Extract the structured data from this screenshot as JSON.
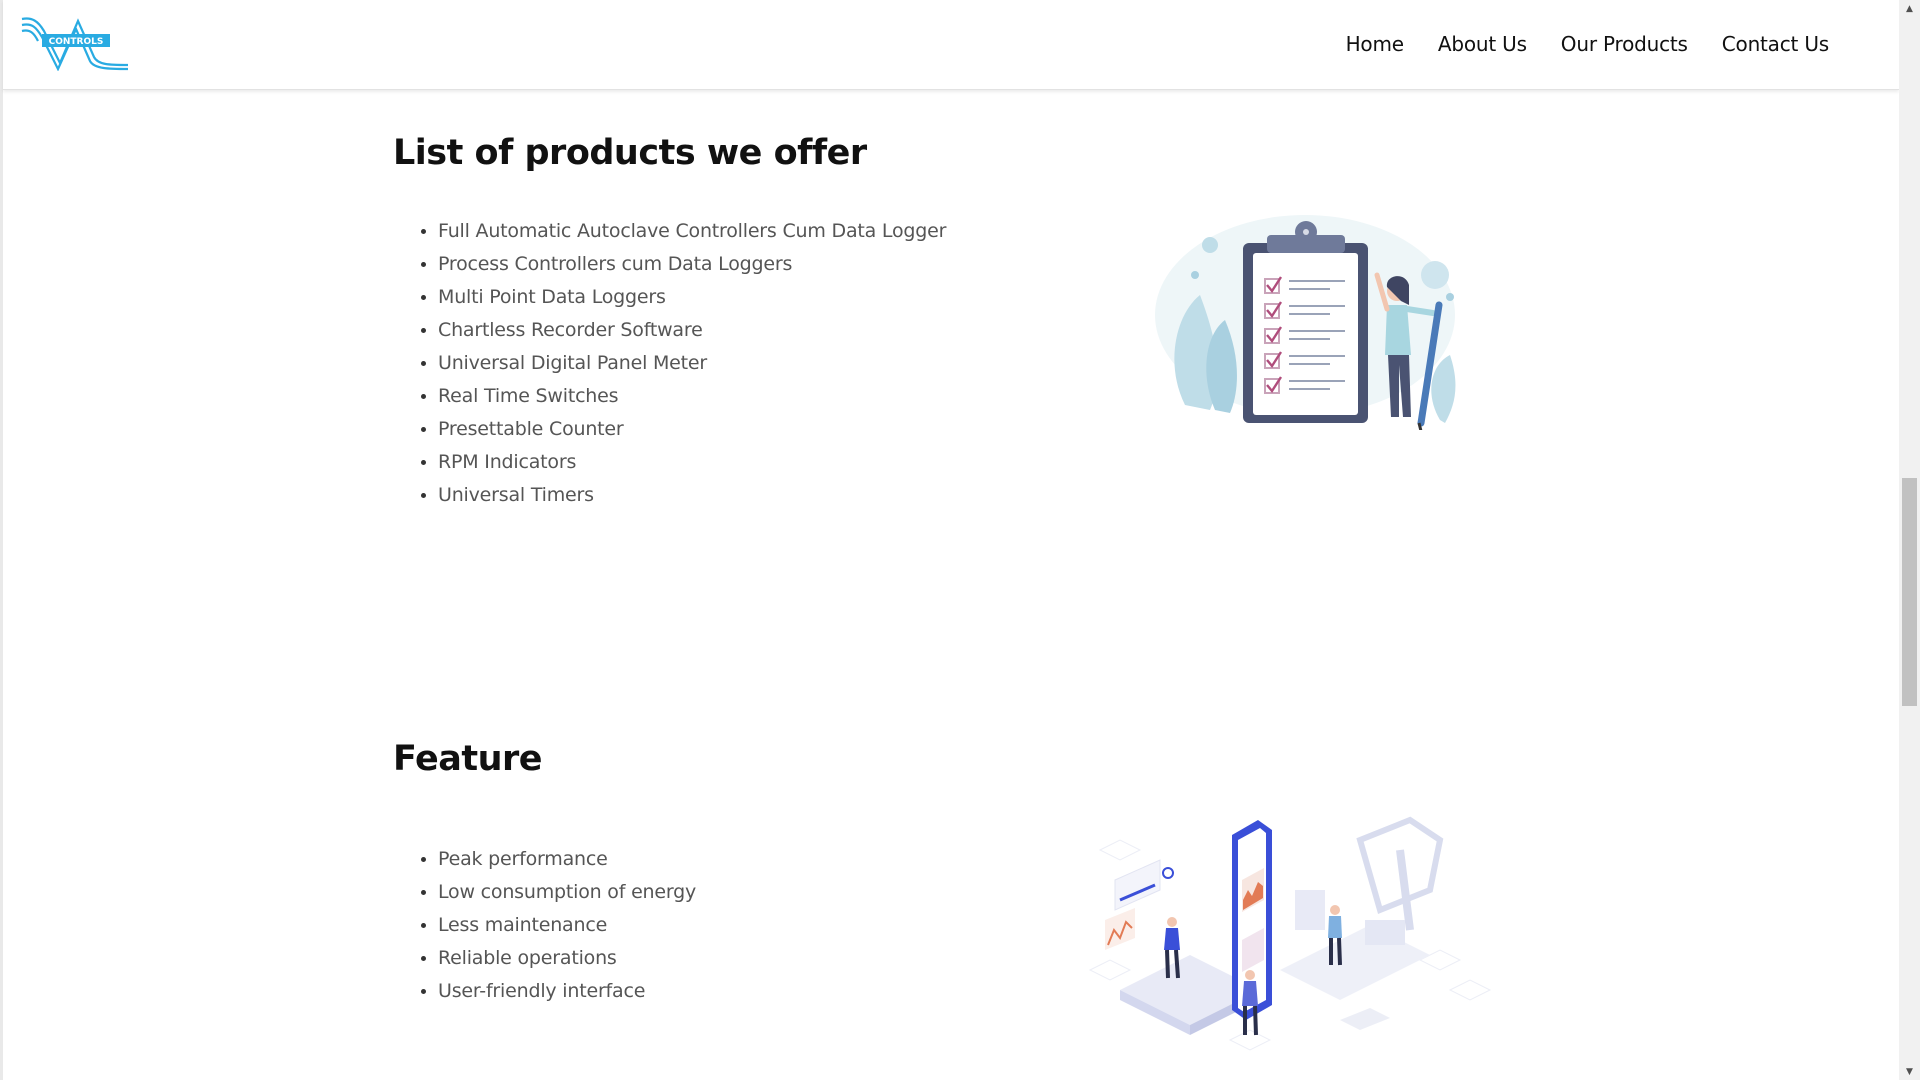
{
  "header": {
    "logo_text": "CONTROLS",
    "nav": [
      "Home",
      "About Us",
      "Our Products",
      "Contact Us"
    ]
  },
  "products": {
    "title": "List of products we offer",
    "items": [
      "Full Automatic Autoclave Controllers Cum Data Logger",
      "Process Controllers cum Data Loggers",
      "Multi Point Data Loggers",
      "Chartless Recorder Software",
      "Universal Digital Panel Meter",
      "Real Time Switches",
      "Presettable Counter",
      "RPM Indicators",
      "Universal Timers"
    ]
  },
  "feature": {
    "title": "Feature",
    "items": [
      "Peak performance",
      "Low consumption of energy",
      "Less maintenance",
      "Reliable operations",
      "User-friendly interface"
    ]
  },
  "colors": {
    "logo": "#29abe2",
    "heading": "#111111",
    "list_text": "#555555",
    "accent_blue": "#3a4fd8"
  },
  "icons": {
    "scroll_up": "▲",
    "scroll_down": "▼"
  }
}
